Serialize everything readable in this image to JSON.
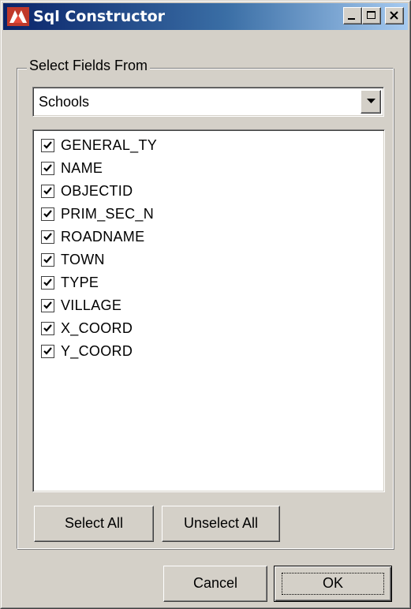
{
  "window": {
    "title": "Sql Constructor",
    "app_icon": "red-white-app-icon",
    "caption_buttons": [
      "minimize-icon",
      "maximize-icon",
      "close-icon"
    ]
  },
  "group": {
    "legend": "Select Fields From"
  },
  "layer_select": {
    "selected": "Schools"
  },
  "fields": [
    {
      "name": "GENERAL_TY",
      "checked": true
    },
    {
      "name": "NAME",
      "checked": true
    },
    {
      "name": "OBJECTID",
      "checked": true
    },
    {
      "name": "PRIM_SEC_N",
      "checked": true
    },
    {
      "name": "ROADNAME",
      "checked": true
    },
    {
      "name": "TOWN",
      "checked": true
    },
    {
      "name": "TYPE",
      "checked": true
    },
    {
      "name": "VILLAGE",
      "checked": true
    },
    {
      "name": "X_COORD",
      "checked": true
    },
    {
      "name": "Y_COORD",
      "checked": true
    }
  ],
  "buttons": {
    "select_all": "Select All",
    "unselect_all": "Unselect All",
    "cancel": "Cancel",
    "ok": "OK"
  },
  "colors": {
    "titlebar_start": "#0a246a",
    "titlebar_end": "#a6caf0",
    "face": "#d4d0c8"
  }
}
